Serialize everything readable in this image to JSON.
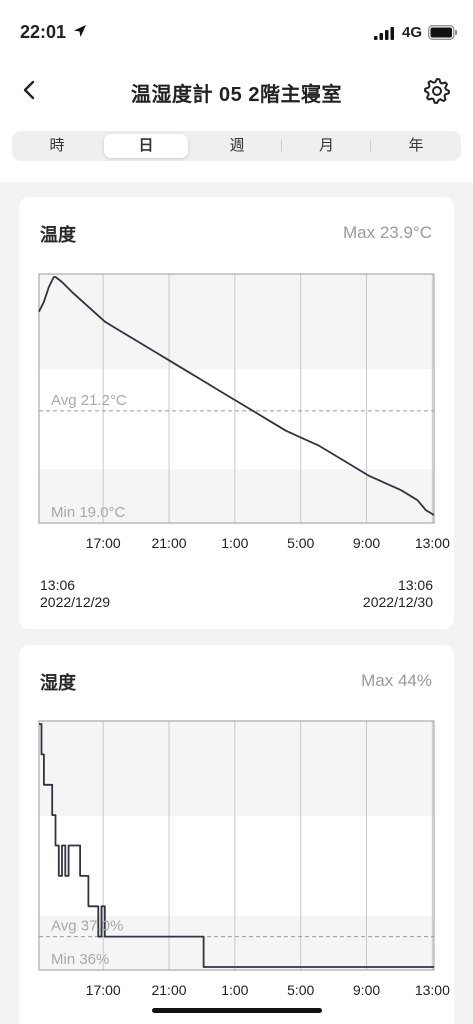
{
  "status_bar": {
    "time": "22:01",
    "network": "4G"
  },
  "nav": {
    "title": "温湿度計 05 2階主寝室"
  },
  "tabs": [
    {
      "label": "時",
      "active": false
    },
    {
      "label": "日",
      "active": true
    },
    {
      "label": "週",
      "active": false
    },
    {
      "label": "月",
      "active": false
    },
    {
      "label": "年",
      "active": false
    }
  ],
  "temperature": {
    "title": "温度",
    "max_label": "Max 23.9°C",
    "avg_label": "Avg 21.2°C",
    "min_label": "Min 19.0°C",
    "range_start": {
      "time": "13:06",
      "date": "2022/12/29"
    },
    "range_end": {
      "time": "13:06",
      "date": "2022/12/30"
    }
  },
  "humidity": {
    "title": "湿度",
    "max_label": "Max 44%",
    "avg_label": "Avg 37.0%",
    "min_label": "Min 36%"
  },
  "chart_data": [
    {
      "type": "line",
      "title": "温度",
      "x_tick_labels": [
        "17:00",
        "21:00",
        "1:00",
        "5:00",
        "9:00",
        "13:00"
      ],
      "ylim": [
        19.0,
        23.9
      ],
      "grid": true,
      "reference_lines": [
        {
          "label": "Avg 21.2°C",
          "value": 21.2
        }
      ],
      "series": [
        {
          "x_hours": [
            0,
            0.3,
            0.6,
            0.9,
            1.0,
            1.4,
            2.0,
            3.0,
            4.0,
            5.0,
            6.0,
            7.0,
            8.0,
            9.0,
            10.0,
            11.0,
            12.0,
            13.0,
            14.0,
            15.0,
            16.0,
            17.0,
            18.0,
            19.0,
            20.0,
            21.0,
            22.0,
            23.0,
            23.5,
            24.0
          ],
          "values": [
            23.2,
            23.4,
            23.7,
            23.9,
            23.9,
            23.8,
            23.6,
            23.3,
            23.0,
            22.8,
            22.6,
            22.4,
            22.2,
            22.0,
            21.8,
            21.6,
            21.4,
            21.2,
            21.0,
            20.8,
            20.65,
            20.5,
            20.3,
            20.1,
            19.9,
            19.75,
            19.6,
            19.4,
            19.2,
            19.1
          ]
        }
      ]
    },
    {
      "type": "line",
      "title": "湿度",
      "x_tick_labels": [
        "17:00",
        "21:00",
        "1:00",
        "5:00",
        "9:00",
        "13:00"
      ],
      "ylim": [
        36,
        44
      ],
      "grid": true,
      "reference_lines": [
        {
          "label": "Avg 37.0%",
          "value": 37.0
        }
      ],
      "series": [
        {
          "x_hours": [
            0,
            0.15,
            0.3,
            0.8,
            1.0,
            1.2,
            1.4,
            1.6,
            1.8,
            2.5,
            3.0,
            3.4,
            3.6,
            3.8,
            4.0,
            4.2,
            4.5,
            5.0,
            6.0,
            7.0,
            8.0,
            10.0,
            12.0,
            16.0,
            20.0,
            24.0
          ],
          "values": [
            44,
            43,
            42,
            41,
            40,
            39,
            40,
            39,
            40,
            39,
            38,
            38,
            37,
            38,
            37,
            37,
            37,
            37,
            37,
            37,
            37,
            36,
            36,
            36,
            36,
            36
          ]
        }
      ]
    }
  ]
}
